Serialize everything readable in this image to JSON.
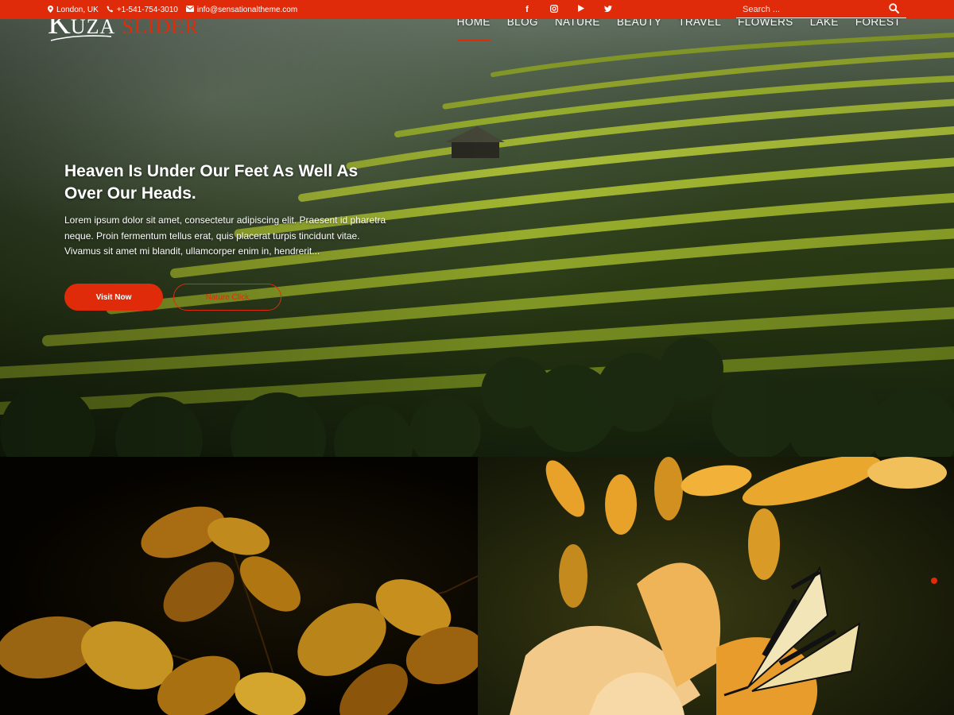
{
  "topbar": {
    "location": "London, UK",
    "phone": "+1-541-754-3010",
    "email": "info@sensationaltheme.com",
    "social": [
      {
        "icon": "facebook-icon",
        "glyph": "f"
      },
      {
        "icon": "instagram-icon",
        "glyph": "◎"
      },
      {
        "icon": "youtube-icon",
        "glyph": "▶"
      },
      {
        "icon": "twitter-icon",
        "glyph": "🐦"
      }
    ],
    "search_placeholder": "Search ..."
  },
  "logo": {
    "k": "K",
    "uza": "UZA",
    "slider": "SLIDER"
  },
  "nav": {
    "items": [
      "HOME",
      "BLOG",
      "NATURE",
      "BEAUTY",
      "TRAVEL",
      "FLOWERS",
      "LAKE",
      "FOREST"
    ],
    "active": "HOME"
  },
  "hero": {
    "title": "Heaven Is Under Our Feet As Well As Over Our Heads.",
    "text": "Lorem ipsum dolor sit amet, consectetur adipiscing elit. Praesent id pharetra neque. Proin fermentum tellus erat, quis placerat turpis tincidunt vitae. Vivamus sit amet mi blandit, ullamcorper enim in, hendrerit...",
    "primary_button": "Visit Now",
    "secondary_button": "Nature Click"
  },
  "colors": {
    "accent": "#e02b0b"
  }
}
